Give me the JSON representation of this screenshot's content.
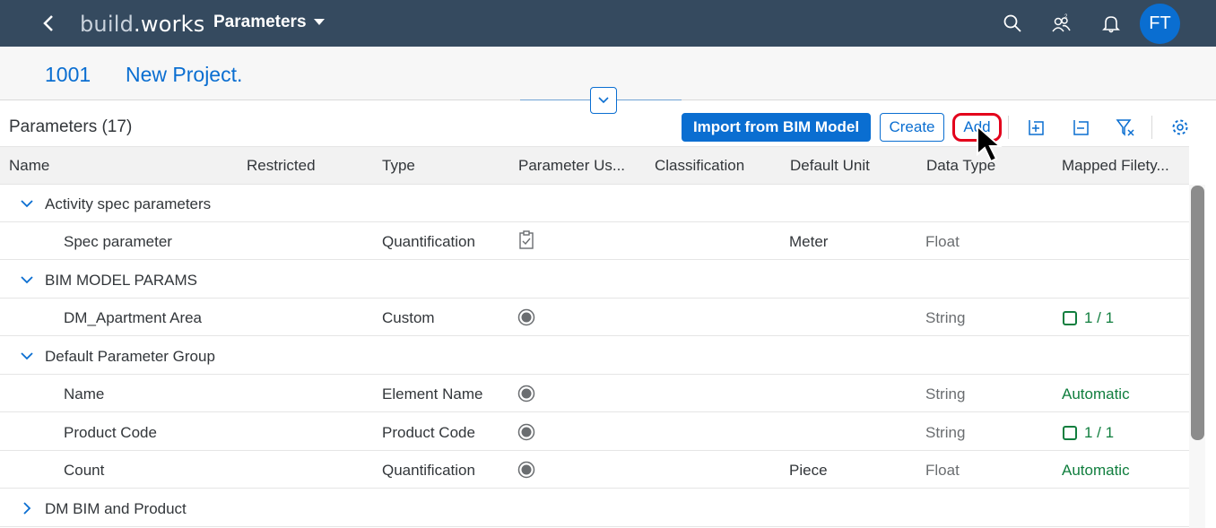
{
  "shell": {
    "logo_prefix": "build",
    "logo_suffix": "works",
    "app_title": "Parameters",
    "avatar_initials": "FT"
  },
  "project": {
    "id": "1001",
    "name": "New Project."
  },
  "toolbar": {
    "title": "Parameters (17)",
    "import_label": "Import from BIM Model",
    "create_label": "Create",
    "add_label": "Add"
  },
  "table": {
    "columns": [
      "Name",
      "Restricted",
      "Type",
      "Parameter Us...",
      "Classification",
      "Default Unit",
      "Data Type",
      "Mapped Filety..."
    ],
    "groups": [
      {
        "label": "Activity spec parameters"
      },
      {
        "label": "BIM MODEL PARAMS"
      },
      {
        "label": "Default Parameter Group"
      },
      {
        "label": "DM BIM and Product"
      }
    ],
    "rows": [
      {
        "name": "Spec parameter",
        "type": "Quantification",
        "unit": "Meter",
        "data_type": "Float",
        "mapped": ""
      },
      {
        "name": "DM_Apartment Area",
        "type": "Custom",
        "unit": "",
        "data_type": "String",
        "mapped": "1 / 1"
      },
      {
        "name": "Name",
        "type": "Element Name",
        "unit": "",
        "data_type": "String",
        "mapped": "Automatic"
      },
      {
        "name": "Product Code",
        "type": "Product Code",
        "unit": "",
        "data_type": "String",
        "mapped": "1 / 1"
      },
      {
        "name": "Count",
        "type": "Quantification",
        "unit": "Piece",
        "data_type": "Float",
        "mapped": "Automatic"
      }
    ]
  },
  "colors": {
    "shell_bg": "#354a5f",
    "accent": "#0a6ed1",
    "success": "#107e3e",
    "highlight": "#e3001b"
  }
}
